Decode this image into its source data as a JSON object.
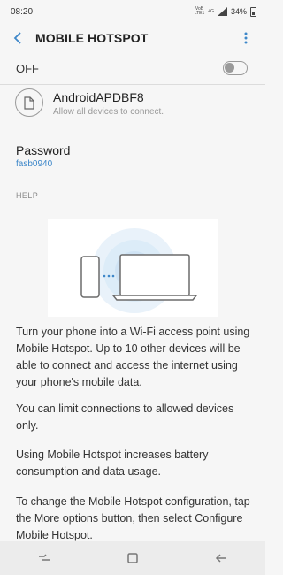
{
  "status_bar": {
    "time": "08:20",
    "network_top": "VoB",
    "network_mid": "LTE1",
    "network_4g": "4G",
    "battery": "34%"
  },
  "header": {
    "title": "MOBILE HOTSPOT"
  },
  "toggle": {
    "label": "OFF",
    "state": "off"
  },
  "network": {
    "name": "AndroidAPDBF8",
    "subtitle": "Allow all devices to connect."
  },
  "password": {
    "label": "Password",
    "value": "fasb0940"
  },
  "help": {
    "label": "HELP",
    "paragraphs": [
      "Turn your phone into a Wi-Fi access point using Mobile Hotspot. Up to 10 other devices will be able to connect and access the internet using your phone's mobile data.",
      "You can limit connections to allowed devices only.",
      "Using Mobile Hotspot increases battery consumption and data usage.",
      "To change the Mobile Hotspot configuration, tap the More options button, then select Configure Mobile Hotspot."
    ]
  },
  "colors": {
    "accent": "#3d87c9",
    "background": "#f6f6f6",
    "halo": "#dcecf8"
  }
}
